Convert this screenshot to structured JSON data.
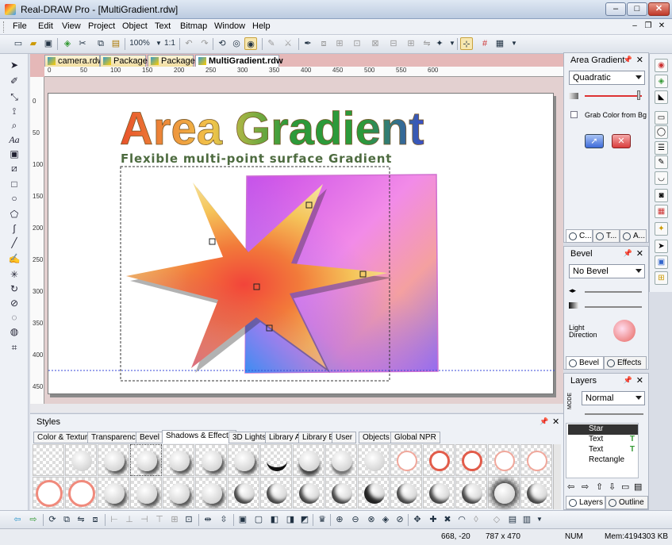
{
  "window": {
    "title": "Real-DRAW Pro - [MultiGradient.rdw]",
    "minimize": "–",
    "maximize": "□",
    "close": "✕"
  },
  "menu": [
    "File",
    "Edit",
    "View",
    "Project",
    "Object",
    "Text",
    "Bitmap",
    "Window",
    "Help"
  ],
  "toolbar": {
    "zoom": "100%",
    "ratio": "1:1"
  },
  "doc_tabs": [
    {
      "label": "camera.rdw",
      "active": false
    },
    {
      "label": "Package",
      "active": false
    },
    {
      "label": "Package",
      "active": false
    },
    {
      "label": "MultiGradient.rdw",
      "active": true
    }
  ],
  "ruler": {
    "h_ticks": [
      "0",
      "50",
      "100",
      "150",
      "200",
      "250",
      "300",
      "350",
      "400",
      "450",
      "500",
      "550",
      "600"
    ],
    "v_ticks": [
      "0",
      "50",
      "100",
      "150",
      "200",
      "250",
      "300",
      "350",
      "400",
      "450"
    ]
  },
  "canvas": {
    "heading": "Area Gradient",
    "subheading": "Flexible multi-point surface Gradient",
    "colors": {
      "gradient_top": "#e8502a",
      "gradient_mid": "#f2c54a",
      "green": "#2c9a3a",
      "blue": "#3a4fc9",
      "sub": "#4d6b3f"
    }
  },
  "styles_panel": {
    "title": "Styles",
    "tabs": [
      {
        "label": "Color & Texture",
        "active": false
      },
      {
        "label": "Transparency",
        "active": false
      },
      {
        "label": "Bevel",
        "active": false
      },
      {
        "label": "Shadows & Effects",
        "active": true
      },
      {
        "label": "3D Lights",
        "active": false
      },
      {
        "label": "Library A",
        "active": false
      },
      {
        "label": "Library B",
        "active": false
      },
      {
        "label": "User",
        "active": false
      },
      {
        "label": "Objects",
        "active": false
      },
      {
        "label": "Global NPR",
        "active": false
      }
    ]
  },
  "area_gradient_panel": {
    "title": "Area Gradient",
    "type": "Quadratic",
    "grab_label": "Grab Color from Bg",
    "bottom_tabs": [
      "C...",
      "T...",
      "A..."
    ]
  },
  "bevel_panel": {
    "title": "Bevel",
    "preset": "No Bevel",
    "light_label_1": "Light",
    "light_label_2": "Direction",
    "tabs": [
      "Bevel",
      "Effects"
    ]
  },
  "layers_panel": {
    "title": "Layers",
    "mode_label": "MODE",
    "mode": "Normal",
    "layers": [
      {
        "name": "Star",
        "selected": true,
        "text_marker": ""
      },
      {
        "name": "Text",
        "selected": false,
        "text_marker": "T"
      },
      {
        "name": "Text",
        "selected": false,
        "text_marker": "T"
      },
      {
        "name": "Rectangle",
        "selected": false,
        "text_marker": ""
      }
    ],
    "tabs": [
      "Layers",
      "Outline"
    ]
  },
  "status": {
    "coords": "668, -20",
    "size": "787 x 470",
    "num": "NUM",
    "mem": "Mem:4194303 KB"
  }
}
